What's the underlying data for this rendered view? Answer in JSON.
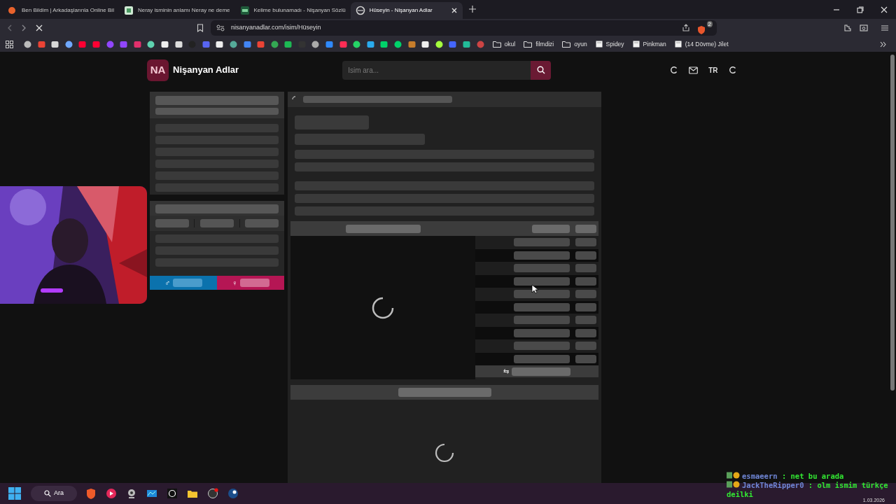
{
  "tabs": [
    {
      "title": "Ben Bildim | Arkadaşlarınla Online Bil",
      "selected": false
    },
    {
      "title": "Neray isminin anlamı Neray ne deme",
      "selected": false
    },
    {
      "title": "Kelime bulunamadı - Nişanyan Sözlü",
      "selected": false
    },
    {
      "title": "Hüseyin - Nişanyan Adlar",
      "selected": true
    }
  ],
  "address_bar": {
    "url": "nisanyanadlar.com/isim/Hüseyin",
    "shield_count": "2"
  },
  "bookmarks": [
    {
      "label": "okul",
      "kind": "folder"
    },
    {
      "label": "filmdizi",
      "kind": "folder"
    },
    {
      "label": "oyun",
      "kind": "folder"
    },
    {
      "label": "Spidey",
      "kind": "page"
    },
    {
      "label": "Pinkman",
      "kind": "page"
    },
    {
      "label": "(14 Dövme) Jilet",
      "kind": "page"
    }
  ],
  "site": {
    "logo": "NA",
    "title": "Nişanyan Adlar",
    "search": {
      "placeholder": "İsim ara..."
    },
    "language": "TR"
  },
  "gender_bar": {
    "male_symbol": "♂",
    "female_symbol": "♀"
  },
  "table_footer": {
    "swap_symbol": "⇆"
  },
  "chat": [
    {
      "user": "esmaeern",
      "lines": [
        ": net bu arada"
      ]
    },
    {
      "user": "JackTheRipper0",
      "lines": [
        ": olm ismim türkçe",
        "deilki"
      ]
    }
  ],
  "taskbar": {
    "search_label": "Ara",
    "date": "1.03.2026"
  }
}
